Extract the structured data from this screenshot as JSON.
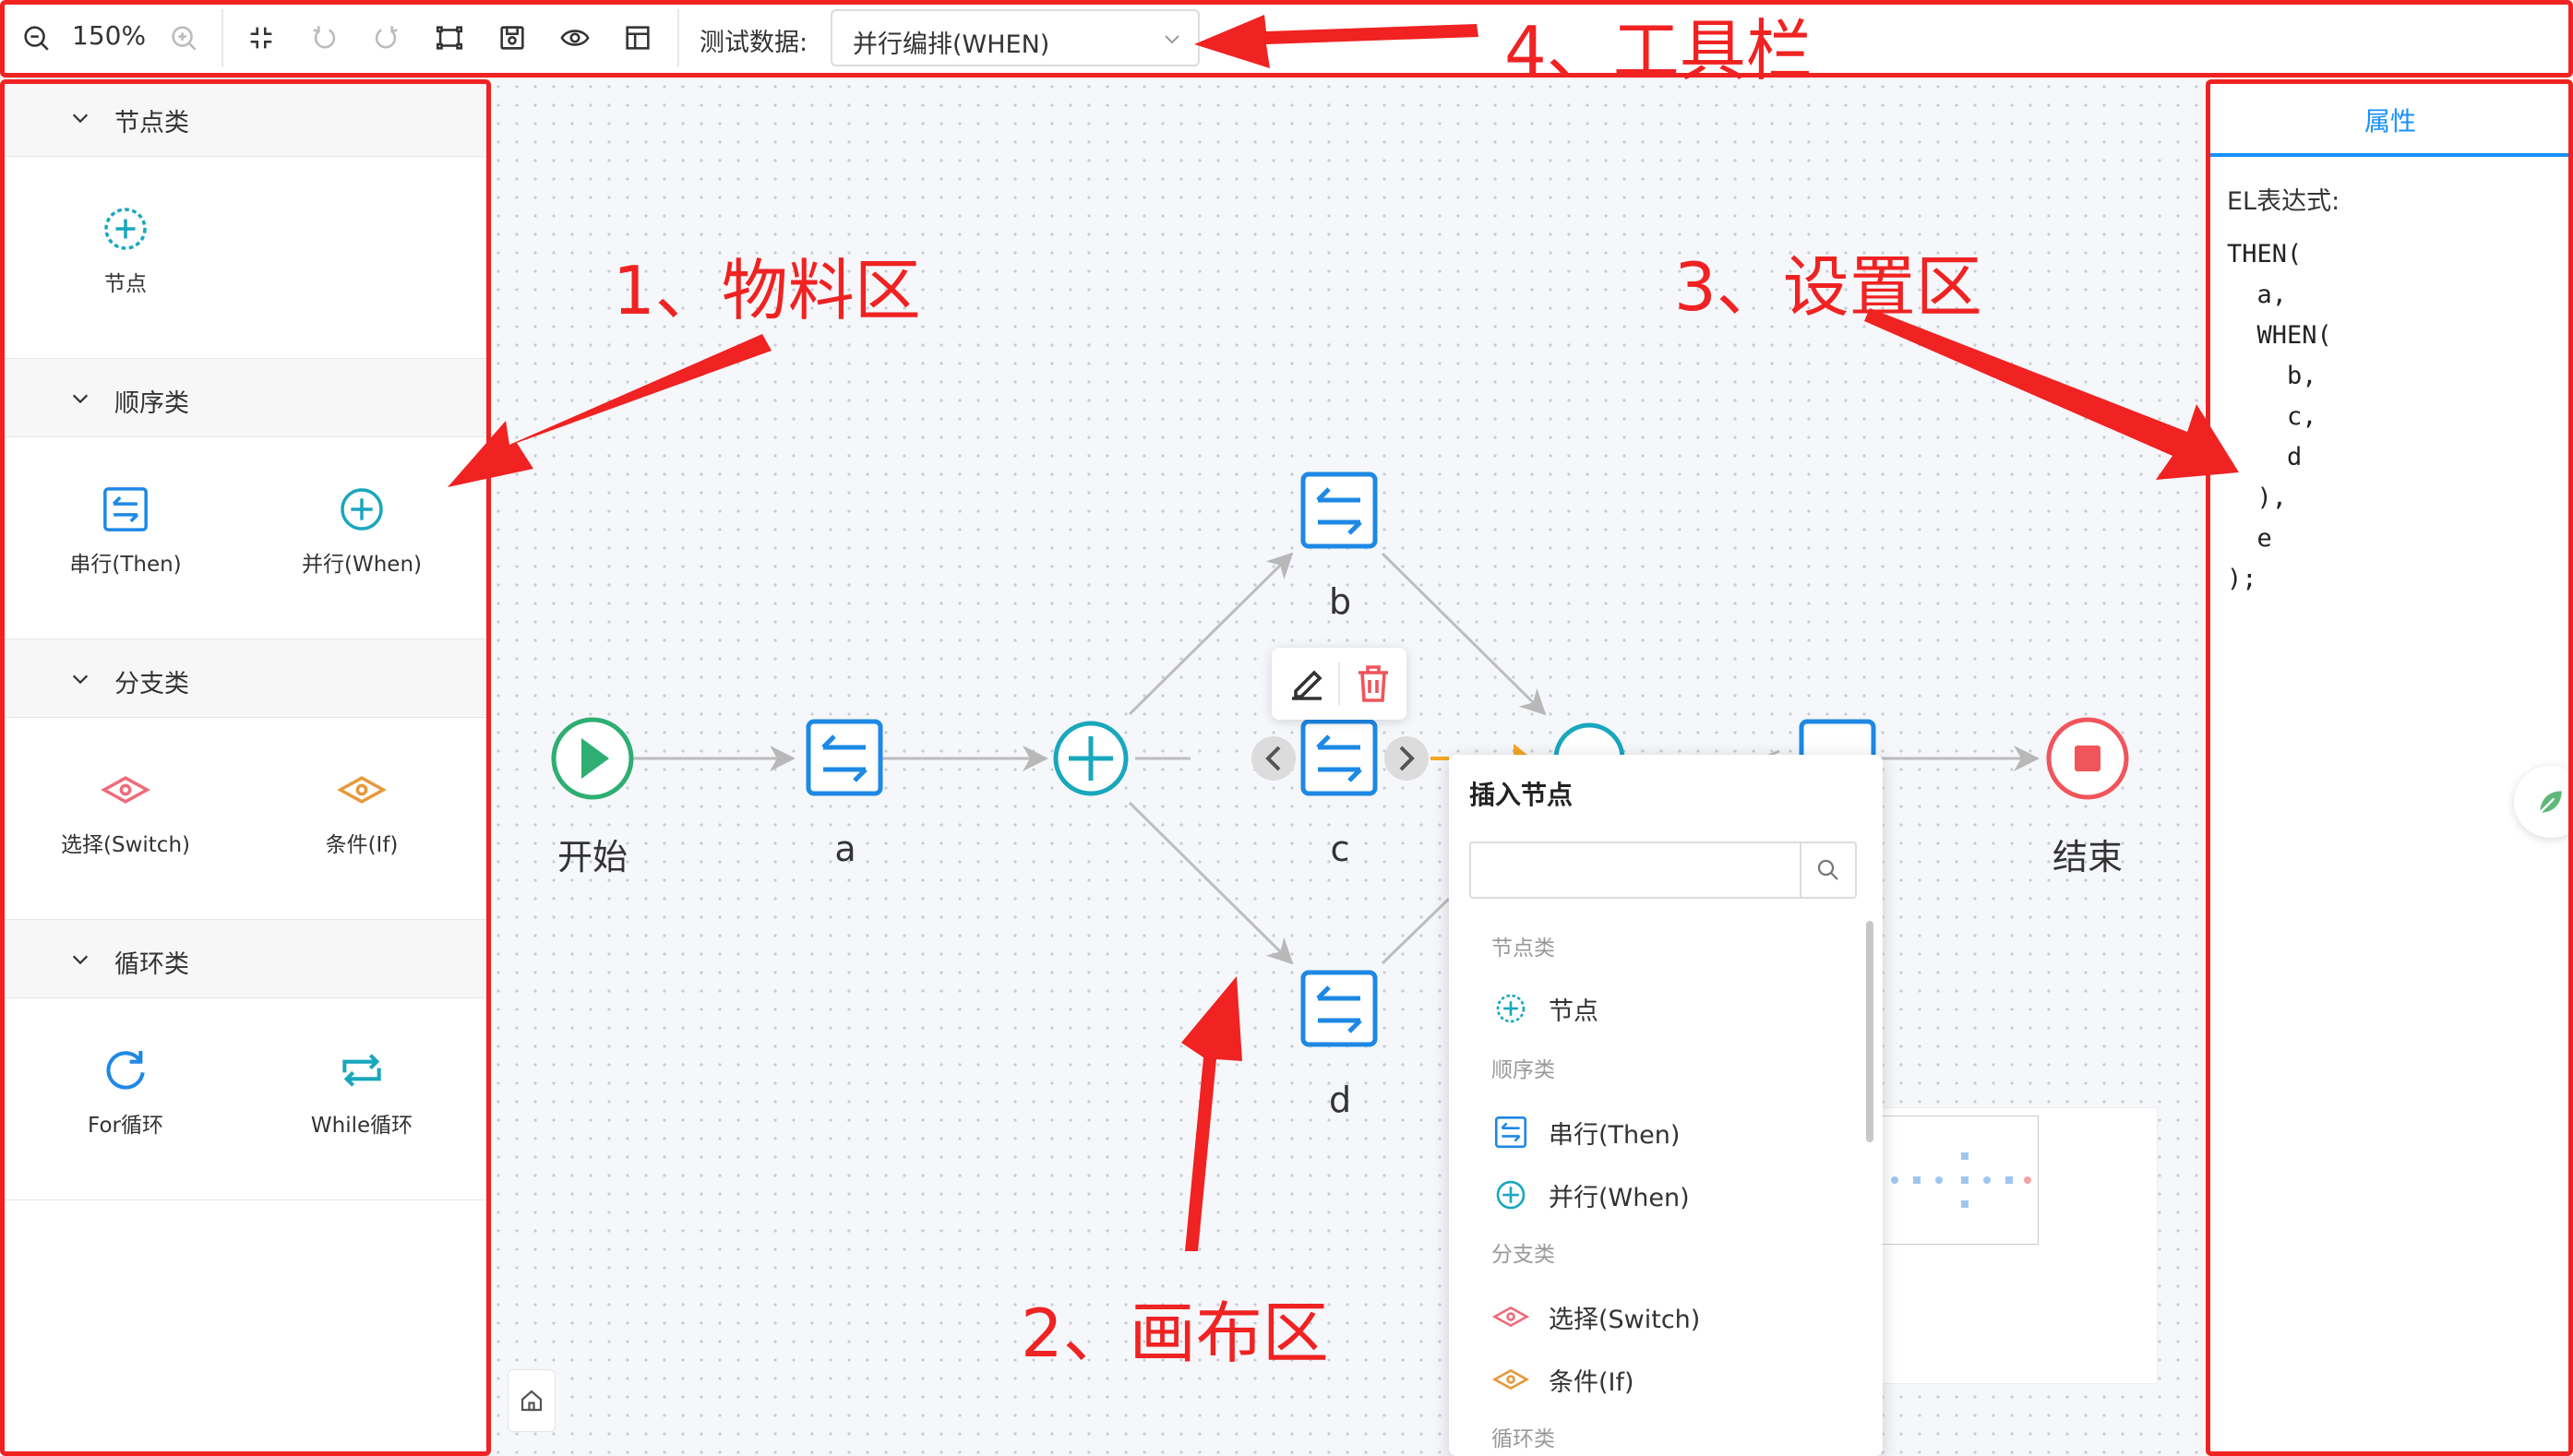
{
  "toolbar": {
    "zoom_level": "150%",
    "test_data_label": "测试数据:",
    "test_data_value": "并行编排(WHEN)",
    "icons": [
      "zoom-out-icon",
      "zoom-in-icon",
      "fit-icon",
      "undo-icon",
      "redo-icon",
      "full-screen-icon",
      "save-icon",
      "preview-icon",
      "layout-icon",
      "chevron-down-icon"
    ]
  },
  "material": {
    "groups": [
      {
        "title": "节点类",
        "items": [
          {
            "label": "节点",
            "icon": "plus-circle-dashed-icon"
          }
        ]
      },
      {
        "title": "顺序类",
        "items": [
          {
            "label": "串行(Then)",
            "icon": "swap-icon"
          },
          {
            "label": "并行(When)",
            "icon": "plus-circle-icon"
          }
        ]
      },
      {
        "title": "分支类",
        "items": [
          {
            "label": "选择(Switch)",
            "icon": "eye-diamond-icon"
          },
          {
            "label": "条件(If)",
            "icon": "eye-diamond-icon"
          }
        ]
      },
      {
        "title": "循环类",
        "items": [
          {
            "label": "For循环",
            "icon": "refresh-icon"
          },
          {
            "label": "While循环",
            "icon": "loop-icon"
          }
        ]
      }
    ]
  },
  "canvas": {
    "nodes": {
      "start": "开始",
      "a": "a",
      "b": "b",
      "c": "c",
      "d": "d",
      "end": "结束"
    }
  },
  "insert_popover": {
    "title": "插入节点",
    "search_placeholder": "",
    "categories": [
      {
        "title": "节点类",
        "items": [
          {
            "label": "节点"
          }
        ]
      },
      {
        "title": "顺序类",
        "items": [
          {
            "label": "串行(Then)"
          },
          {
            "label": "并行(When)"
          }
        ]
      },
      {
        "title": "分支类",
        "items": [
          {
            "label": "选择(Switch)"
          },
          {
            "label": "条件(If)"
          }
        ]
      },
      {
        "title": "循环类",
        "items": []
      }
    ]
  },
  "properties": {
    "tab_label": "属性",
    "el_label": "EL表达式:",
    "el_expression": "THEN(\n  a,\n  WHEN(\n    b,\n    c,\n    d\n  ),\n  e\n);"
  },
  "annotations": {
    "material": "1、物料区",
    "canvas": "2、画布区",
    "settings": "3、设置区",
    "toolbar": "4、工具栏"
  },
  "colors": {
    "accent": "#1890ff",
    "node_blue": "#1e88e5",
    "when_teal": "#19a7bd",
    "start_green": "#2eae73",
    "end_red": "#f0555b",
    "switch_pink": "#ef6b7a",
    "if_orange": "#e59a3a",
    "annotation_red": "#f02222"
  }
}
